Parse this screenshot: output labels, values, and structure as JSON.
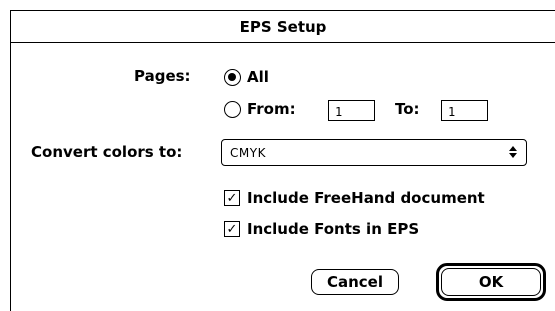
{
  "dialog": {
    "title": "EPS Setup"
  },
  "pages": {
    "label": "Pages:",
    "all_label": "All",
    "from_label": "From:",
    "from_value": "1",
    "to_label": "To:",
    "to_value": "1",
    "selected": "All"
  },
  "convert": {
    "label": "Convert colors to:",
    "value": "CMYK"
  },
  "checkboxes": [
    {
      "label": "Include FreeHand document",
      "checked": true
    },
    {
      "label": "Include Fonts in EPS",
      "checked": true
    }
  ],
  "buttons": {
    "cancel": "Cancel",
    "ok": "OK"
  }
}
